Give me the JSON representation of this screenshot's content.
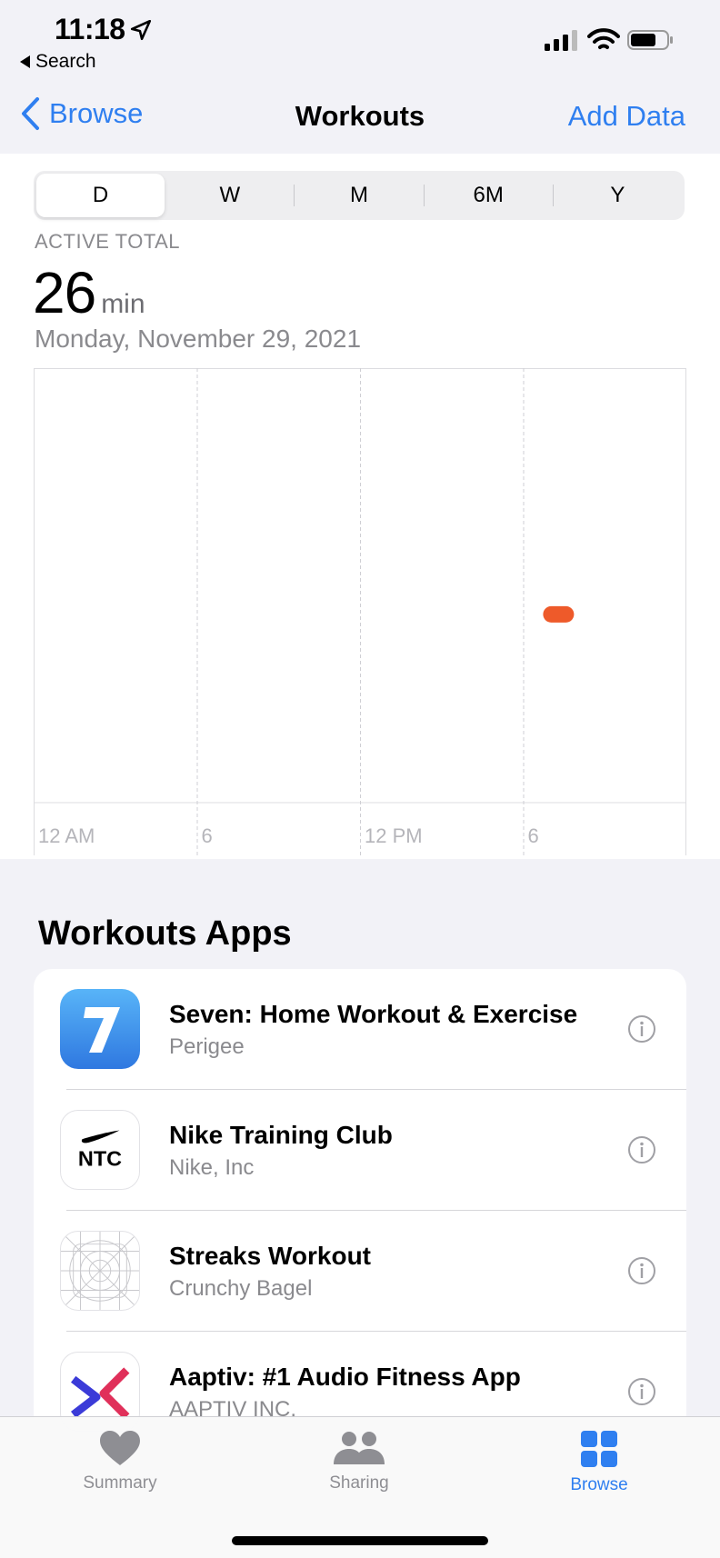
{
  "status_bar": {
    "time": "11:18",
    "back_app": "Search"
  },
  "nav": {
    "back_label": "Browse",
    "title": "Workouts",
    "action_label": "Add Data"
  },
  "segments": [
    {
      "label": "D",
      "selected": true
    },
    {
      "label": "W",
      "selected": false
    },
    {
      "label": "M",
      "selected": false
    },
    {
      "label": "6M",
      "selected": false
    },
    {
      "label": "Y",
      "selected": false
    }
  ],
  "summary": {
    "label": "ACTIVE TOTAL",
    "value": "26",
    "unit": "min",
    "date": "Monday, November 29, 2021"
  },
  "chart_data": {
    "type": "scatter",
    "x_tick_labels": [
      "12 AM",
      "6",
      "12 PM",
      "6"
    ],
    "xlim_hours": [
      0,
      24
    ],
    "grid": true,
    "accent_color": "#ee5a2a",
    "points": [
      {
        "hour": 19.3,
        "minutes": 26
      }
    ],
    "ylim": [
      0,
      60
    ]
  },
  "apps_section": {
    "title": "Workouts Apps",
    "apps": [
      {
        "name": "Seven: Home Workout & Exercise",
        "developer": "Perigee",
        "icon": "seven-app-icon"
      },
      {
        "name": "Nike Training Club",
        "developer": "Nike, Inc",
        "icon": "ntc-app-icon",
        "icon_text": "NTC"
      },
      {
        "name": "Streaks Workout",
        "developer": "Crunchy Bagel",
        "icon": "streaks-app-icon"
      },
      {
        "name": "Aaptiv: #1 Audio Fitness App",
        "developer": "AAPTIV INC.",
        "icon": "aaptiv-app-icon"
      }
    ]
  },
  "tabs": [
    {
      "label": "Summary",
      "icon": "heart-icon",
      "selected": false
    },
    {
      "label": "Sharing",
      "icon": "people-icon",
      "selected": false
    },
    {
      "label": "Browse",
      "icon": "grid-icon",
      "selected": true
    }
  ],
  "colors": {
    "tint": "#2f7ff0",
    "workout": "#ee5a2a",
    "tab_inactive": "#8e8e93"
  }
}
